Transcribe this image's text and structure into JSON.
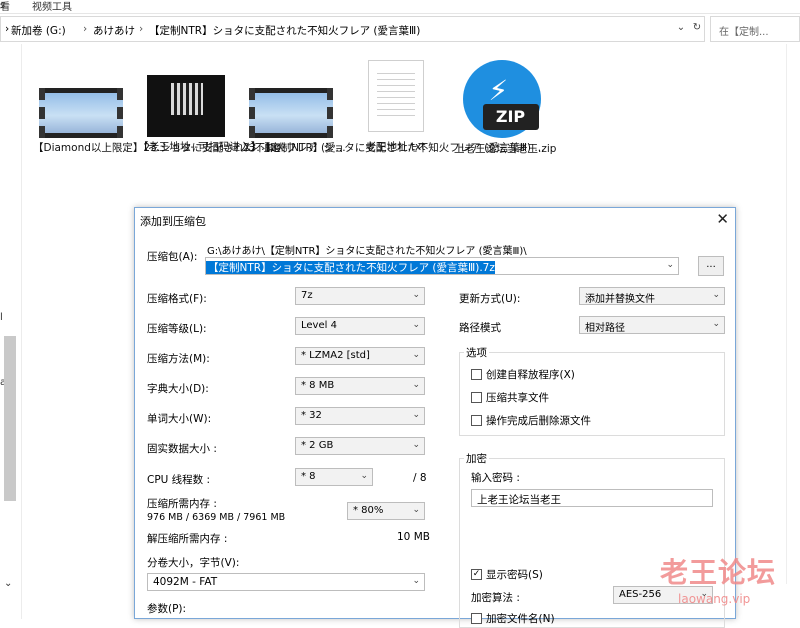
{
  "explorer": {
    "ribbon": {
      "left": "看",
      "right": "视频工具"
    },
    "breadcrumb": {
      "drive": "新加卷 (G:)",
      "folder1": "あけあけ",
      "folder2": "【定制NTR】ショタに支配された不知火フレア (愛言葉Ⅲ)"
    },
    "search_placeholder": "在【定制...",
    "left_marks": [
      "s",
      "l",
      "a"
    ],
    "files": [
      {
        "name": "【Diamond以上限定】23.ショタに支配された不知火フレア (愛...",
        "type": "video"
      },
      {
        "name": "【老王地址--可扫码进入】.jpg",
        "type": "image"
      },
      {
        "name": "23.【定制NTR】ショタに支配された不知火フレア (愛言葉Ⅲ) ...",
        "type": "video"
      },
      {
        "name": "老王地址.txt",
        "type": "text"
      },
      {
        "name": "上老王论坛当老王.zip",
        "type": "zip",
        "badge": "ZIP"
      }
    ]
  },
  "dialog": {
    "title": "添加到压缩包",
    "archive_label": "压缩包(A):",
    "archive_path": "G:\\あけあけ\\【定制NTR】ショタに支配された不知火フレア (愛言葉Ⅲ)\\",
    "archive_name": "【定制NTR】ショタに支配された不知火フレア (愛言葉Ⅲ).7z",
    "browse_label": "...",
    "rows": [
      {
        "label": "压缩格式(F):",
        "value": "7z"
      },
      {
        "label": "压缩等级(L):",
        "value": "Level 4"
      },
      {
        "label": "压缩方法(M):",
        "value": "* LZMA2 [std]"
      },
      {
        "label": "字典大小(D):",
        "value": "* 8 MB"
      },
      {
        "label": "单词大小(W):",
        "value": "* 32"
      },
      {
        "label": "固实数据大小 :",
        "value": "* 2 GB"
      }
    ],
    "cpu": {
      "label": "CPU 线程数 :",
      "value": "* 8",
      "max": "/ 8"
    },
    "mem": {
      "label": "压缩所需内存 :",
      "detail": "976 MB / 6369 MB / 7961 MB",
      "value": "* 80%"
    },
    "decomp": {
      "label": "解压缩所需内存 :",
      "value": "10 MB"
    },
    "volume": {
      "label": "分卷大小，字节(V):",
      "value": "4092M - FAT"
    },
    "params_label": "参数(P):",
    "update": {
      "label": "更新方式(U):",
      "value": "添加并替换文件"
    },
    "pathmode": {
      "label": "路径模式",
      "value": "相对路径"
    },
    "options": {
      "title": "选项",
      "items": [
        {
          "label": "创建自释放程序(X)",
          "checked": false
        },
        {
          "label": "压缩共享文件",
          "checked": false
        },
        {
          "label": "操作完成后删除源文件",
          "checked": false
        }
      ]
    },
    "encryption": {
      "title": "加密",
      "pw_label": "输入密码 :",
      "pw_value": "上老王论坛当老王",
      "show_pw": {
        "label": "显示密码(S)",
        "checked": true
      },
      "method_label": "加密算法 :",
      "method_value": "AES-256",
      "encrypt_names": {
        "label": "加密文件名(N)",
        "checked": false
      }
    }
  },
  "watermark": {
    "text": "老王论坛",
    "sub": "laowang.vip"
  },
  "colors": {
    "accent": "#1f8fe0",
    "selection": "#0078d7",
    "watermark": "#f08a8a"
  }
}
